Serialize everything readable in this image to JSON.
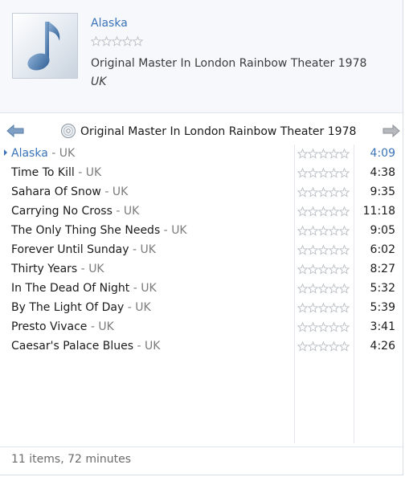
{
  "now_playing": {
    "title": "Alaska",
    "album": "Original Master In London Rainbow Theater 1978",
    "artist": "UK",
    "rating": 0,
    "art_icon": "music-note-icon"
  },
  "nav": {
    "back_icon": "arrow-left-icon",
    "forward_icon": "arrow-right-icon",
    "disc_icon": "cd-icon",
    "album_title": "Original Master In London Rainbow Theater 1978"
  },
  "tracks": [
    {
      "title": "Alaska",
      "separator": " - ",
      "artist": "UK",
      "duration": "4:09",
      "rating": 0,
      "playing": true
    },
    {
      "title": "Time To Kill",
      "separator": " - ",
      "artist": "UK",
      "duration": "4:38",
      "rating": 0,
      "playing": false
    },
    {
      "title": "Sahara Of Snow",
      "separator": " - ",
      "artist": "UK",
      "duration": "9:35",
      "rating": 0,
      "playing": false
    },
    {
      "title": "Carrying No Cross",
      "separator": " - ",
      "artist": "UK",
      "duration": "11:18",
      "rating": 0,
      "playing": false
    },
    {
      "title": "The Only Thing She Needs",
      "separator": " - ",
      "artist": "UK",
      "duration": "9:05",
      "rating": 0,
      "playing": false
    },
    {
      "title": "Forever Until Sunday",
      "separator": " - ",
      "artist": "UK",
      "duration": "6:02",
      "rating": 0,
      "playing": false
    },
    {
      "title": "Thirty Years",
      "separator": " - ",
      "artist": "UK",
      "duration": "8:27",
      "rating": 0,
      "playing": false
    },
    {
      "title": "In The Dead Of Night",
      "separator": " - ",
      "artist": "UK",
      "duration": "5:32",
      "rating": 0,
      "playing": false
    },
    {
      "title": "By The Light Of Day",
      "separator": " - ",
      "artist": "UK",
      "duration": "5:39",
      "rating": 0,
      "playing": false
    },
    {
      "title": "Presto Vivace",
      "separator": " - ",
      "artist": "UK",
      "duration": "3:41",
      "rating": 0,
      "playing": false
    },
    {
      "title": "Caesar's Palace Blues",
      "separator": " - ",
      "artist": "UK",
      "duration": "4:26",
      "rating": 0,
      "playing": false
    }
  ],
  "footer": {
    "summary": "11 items, 72 minutes"
  },
  "colors": {
    "accent": "#3a73b8",
    "secondary_text": "#7b7b7b",
    "star_outline": "#b9bec5"
  }
}
